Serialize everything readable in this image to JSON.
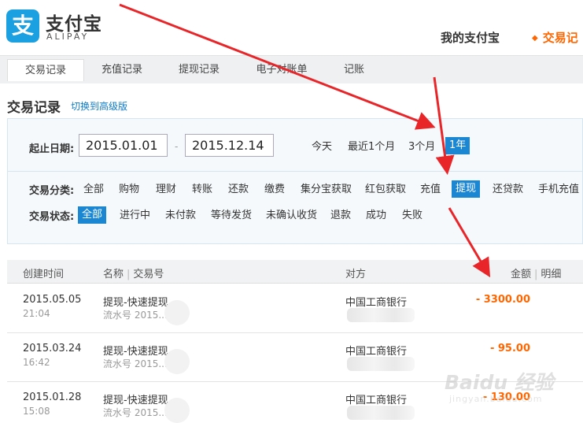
{
  "header": {
    "logo_icon_char": "支",
    "logo_cn": "支付宝",
    "logo_en": "ALIPAY",
    "nav_mine": "我的支付宝",
    "nav_trade_dot": "◆",
    "nav_trade": "交易记"
  },
  "tabs": [
    {
      "label": "交易记录",
      "active": true
    },
    {
      "label": "充值记录",
      "active": false
    },
    {
      "label": "提现记录",
      "active": false
    },
    {
      "label": "电子对账单",
      "active": false
    },
    {
      "label": "记账",
      "active": false
    }
  ],
  "section": {
    "title": "交易记录",
    "switch_link": "切换到高级版"
  },
  "filter": {
    "date_label": "起止日期:",
    "start_date": "2015.01.01",
    "end_date": "2015.12.14",
    "date_sep": "-",
    "date_ranges": [
      {
        "label": "今天",
        "active": false
      },
      {
        "label": "最近1个月",
        "active": false
      },
      {
        "label": "3个月",
        "active": false
      },
      {
        "label": "1年",
        "active": true
      }
    ],
    "category_label": "交易分类:",
    "categories": [
      {
        "label": "全部",
        "active": false
      },
      {
        "label": "购物",
        "active": false
      },
      {
        "label": "理财",
        "active": false
      },
      {
        "label": "转账",
        "active": false
      },
      {
        "label": "还款",
        "active": false
      },
      {
        "label": "缴费",
        "active": false
      },
      {
        "label": "集分宝获取",
        "active": false
      },
      {
        "label": "红包获取",
        "active": false
      },
      {
        "label": "充值",
        "active": false
      },
      {
        "label": "提现",
        "active": true
      },
      {
        "label": "还贷款",
        "active": false
      },
      {
        "label": "手机充值",
        "active": false
      }
    ],
    "status_label": "交易状态:",
    "statuses": [
      {
        "label": "全部",
        "active": true
      },
      {
        "label": "进行中",
        "active": false
      },
      {
        "label": "未付款",
        "active": false
      },
      {
        "label": "等待发货",
        "active": false
      },
      {
        "label": "未确认收货",
        "active": false
      },
      {
        "label": "退款",
        "active": false
      },
      {
        "label": "成功",
        "active": false
      },
      {
        "label": "失败",
        "active": false
      }
    ]
  },
  "table": {
    "headers": {
      "created": "创建时间",
      "name": "名称",
      "sep": "|",
      "trade_no": "交易号",
      "party": "对方",
      "amount": "金额",
      "detail": "明细"
    },
    "rows": [
      {
        "date": "2015.05.05",
        "time": "21:04",
        "name": "提现-快速提现",
        "serial": "流水号 2015...",
        "party": "中国工商银行",
        "amount": "- 3300.00"
      },
      {
        "date": "2015.03.24",
        "time": "16:42",
        "name": "提现-快速提现",
        "serial": "流水号 2015...",
        "party": "中国工商银行",
        "amount": "- 95.00"
      },
      {
        "date": "2015.01.28",
        "time": "15:08",
        "name": "提现-快速提现",
        "serial": "流水号 2015...",
        "party": "中国工商银行",
        "amount": "- 130.00"
      }
    ]
  },
  "watermark": {
    "text": "Baidu 经验",
    "sub": "jingyan.baidu.com"
  },
  "colors": {
    "accent_orange": "#ff6600",
    "active_blue": "#1b86d1",
    "arrow_red": "#e8262a"
  }
}
